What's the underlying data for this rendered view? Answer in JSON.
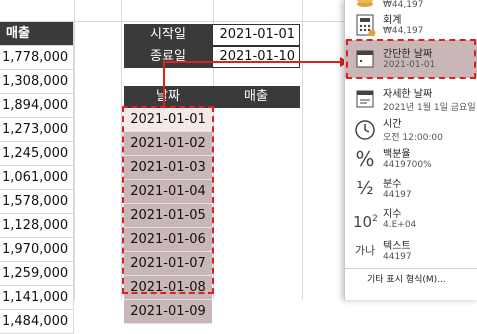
{
  "sales_column": {
    "header": "매출",
    "values": [
      "1,778,000",
      "1,308,000",
      "1,894,000",
      "1,273,000",
      "1,245,000",
      "1,061,000",
      "1,578,000",
      "1,128,000",
      "1,970,000",
      "1,259,000",
      "1,141,000",
      "1,484,000"
    ]
  },
  "start": {
    "label": "시작일",
    "value": "2021-01-01"
  },
  "end": {
    "label": "종료일",
    "value": "2021-01-10"
  },
  "table": {
    "date_header": "날짜",
    "sales_header": "매출",
    "dates": [
      "2021-01-01",
      "2021-01-02",
      "2021-01-03",
      "2021-01-04",
      "2021-01-05",
      "2021-01-06",
      "2021-01-07",
      "2021-01-08",
      "2021-01-09"
    ]
  },
  "format_menu": {
    "items": [
      {
        "label": "",
        "sample": "₩44,197",
        "icon": "coins-icon"
      },
      {
        "label": "회계",
        "sample": "₩44,197",
        "icon": "accounting-icon"
      },
      {
        "label": "간단한 날짜",
        "sample": "2021-01-01",
        "icon": "calendar-icon",
        "selected": true
      },
      {
        "label": "자세한 날짜",
        "sample": "2021년 1월 1일 금요일",
        "icon": "calendar-long-icon"
      },
      {
        "label": "시간",
        "sample": "오전 12:00:00",
        "icon": "clock-icon"
      },
      {
        "label": "백분율",
        "sample": "4419700%",
        "icon": "percent-icon"
      },
      {
        "label": "분수",
        "sample": "44197",
        "icon": "fraction-icon"
      },
      {
        "label": "지수",
        "sample": "4.E+04",
        "icon": "exponent-icon"
      },
      {
        "label": "텍스트",
        "sample": "44197",
        "icon": "text-icon"
      }
    ],
    "more": "기타 표시 형식(M)..."
  },
  "colors": {
    "highlight": "#c9b7b7",
    "dash": "#e0201e",
    "header_bg": "#3a3a3a"
  }
}
